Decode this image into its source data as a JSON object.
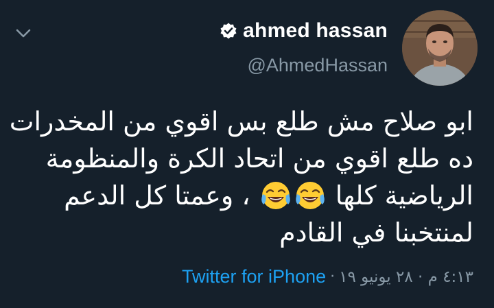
{
  "user": {
    "display_name": "ahmed hassan",
    "handle": "@AhmedHassan",
    "verified": true
  },
  "tweet": {
    "lines": [
      "ابو صلاح مش طلع بس اقوي من المخدرات",
      "ده طلع اقوي من اتحاد الكرة والمنظومة",
      "الرياضية كلها",
      "، وعمتا كل الدعم",
      "لمنتخبنا في القادم"
    ],
    "emoji": [
      "face-with-tears-of-joy",
      "face-with-tears-of-joy"
    ]
  },
  "meta": {
    "timestamp": "٤:١٣ م · ٢٨ يونيو ١٩",
    "separator": "·",
    "source": "Twitter for iPhone"
  },
  "colors": {
    "background": "#15202b",
    "primary_text": "#ffffff",
    "secondary_text": "#8899a6",
    "link": "#1da1f2"
  },
  "icons": {
    "menu": "chevron-down-icon",
    "verified": "verified-badge-icon"
  }
}
